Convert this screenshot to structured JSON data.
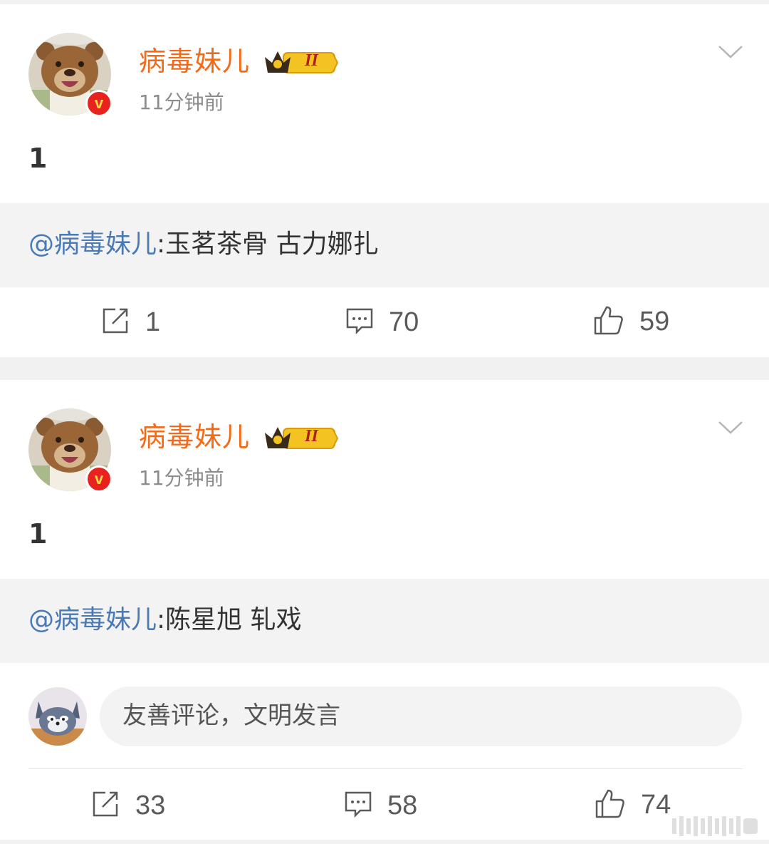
{
  "posts": [
    {
      "username": "病毒妹儿",
      "badge_level": "II",
      "time": "11分钟前",
      "text": "1",
      "quote": {
        "mention": "@病毒妹儿",
        "text": ":玉茗茶骨 古力娜扎"
      },
      "actions": {
        "repost": "1",
        "comment": "70",
        "like": "59"
      }
    },
    {
      "username": "病毒妹儿",
      "badge_level": "II",
      "time": "11分钟前",
      "text": "1",
      "quote": {
        "mention": "@病毒妹儿",
        "text": ":陈星旭 轧戏"
      },
      "comment_input": {
        "placeholder": "友善评论，文明发言"
      },
      "actions": {
        "repost": "33",
        "comment": "58",
        "like": "74"
      }
    }
  ],
  "verified_mark": "v",
  "colors": {
    "username": "#f56a18",
    "mention": "#4a7ab5",
    "verified": "#e8231f"
  }
}
